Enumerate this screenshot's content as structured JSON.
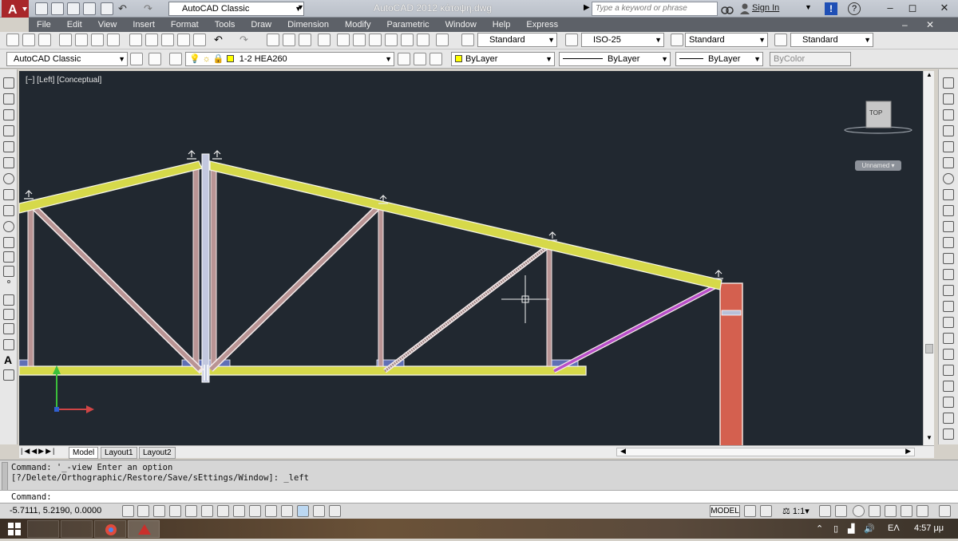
{
  "titlebar": {
    "title": "AutoCAD 2012    κάτοψη.dwg",
    "workspace": "AutoCAD Classic",
    "search_placeholder": "Type a keyword or phrase",
    "signin": "Sign In"
  },
  "menu": [
    "File",
    "Edit",
    "View",
    "Insert",
    "Format",
    "Tools",
    "Draw",
    "Dimension",
    "Modify",
    "Parametric",
    "Window",
    "Help",
    "Express"
  ],
  "styles_toolbar": {
    "text_style": "Standard",
    "dim_style": "ISO-25",
    "table_style": "Standard",
    "multileader_style": "Standard"
  },
  "layers_toolbar": {
    "workspace": "AutoCAD Classic",
    "layer": "1-2 HEA260",
    "color": "ByLayer",
    "linetype": "ByLayer",
    "lineweight": "ByLayer",
    "plotstyle": "ByColor"
  },
  "viewport": {
    "label": "[−] [Left] [Conceptual]",
    "viewcube_face": "TOP",
    "ucs_name": "Unnamed"
  },
  "layout_tabs": [
    "Model",
    "Layout1",
    "Layout2"
  ],
  "command": {
    "history_1": "Command:  '_-view Enter an option",
    "history_2": "[?/Delete/Orthographic/Restore/Save/sEttings/Window]: _left",
    "prompt": "Command:"
  },
  "status": {
    "coordinates": "-5.7111, 5.2190, 0.0000",
    "model_label": "MODEL",
    "annotation_scale": "1:1"
  },
  "taskbar": {
    "language": "ΕΛ",
    "clock": "4:57 μμ"
  },
  "colors": {
    "canvas_bg": "#212830",
    "chord": "#d6d94a",
    "web_member": "#b99494",
    "selected_member": "#b94fc9",
    "column": "#d4604f"
  }
}
